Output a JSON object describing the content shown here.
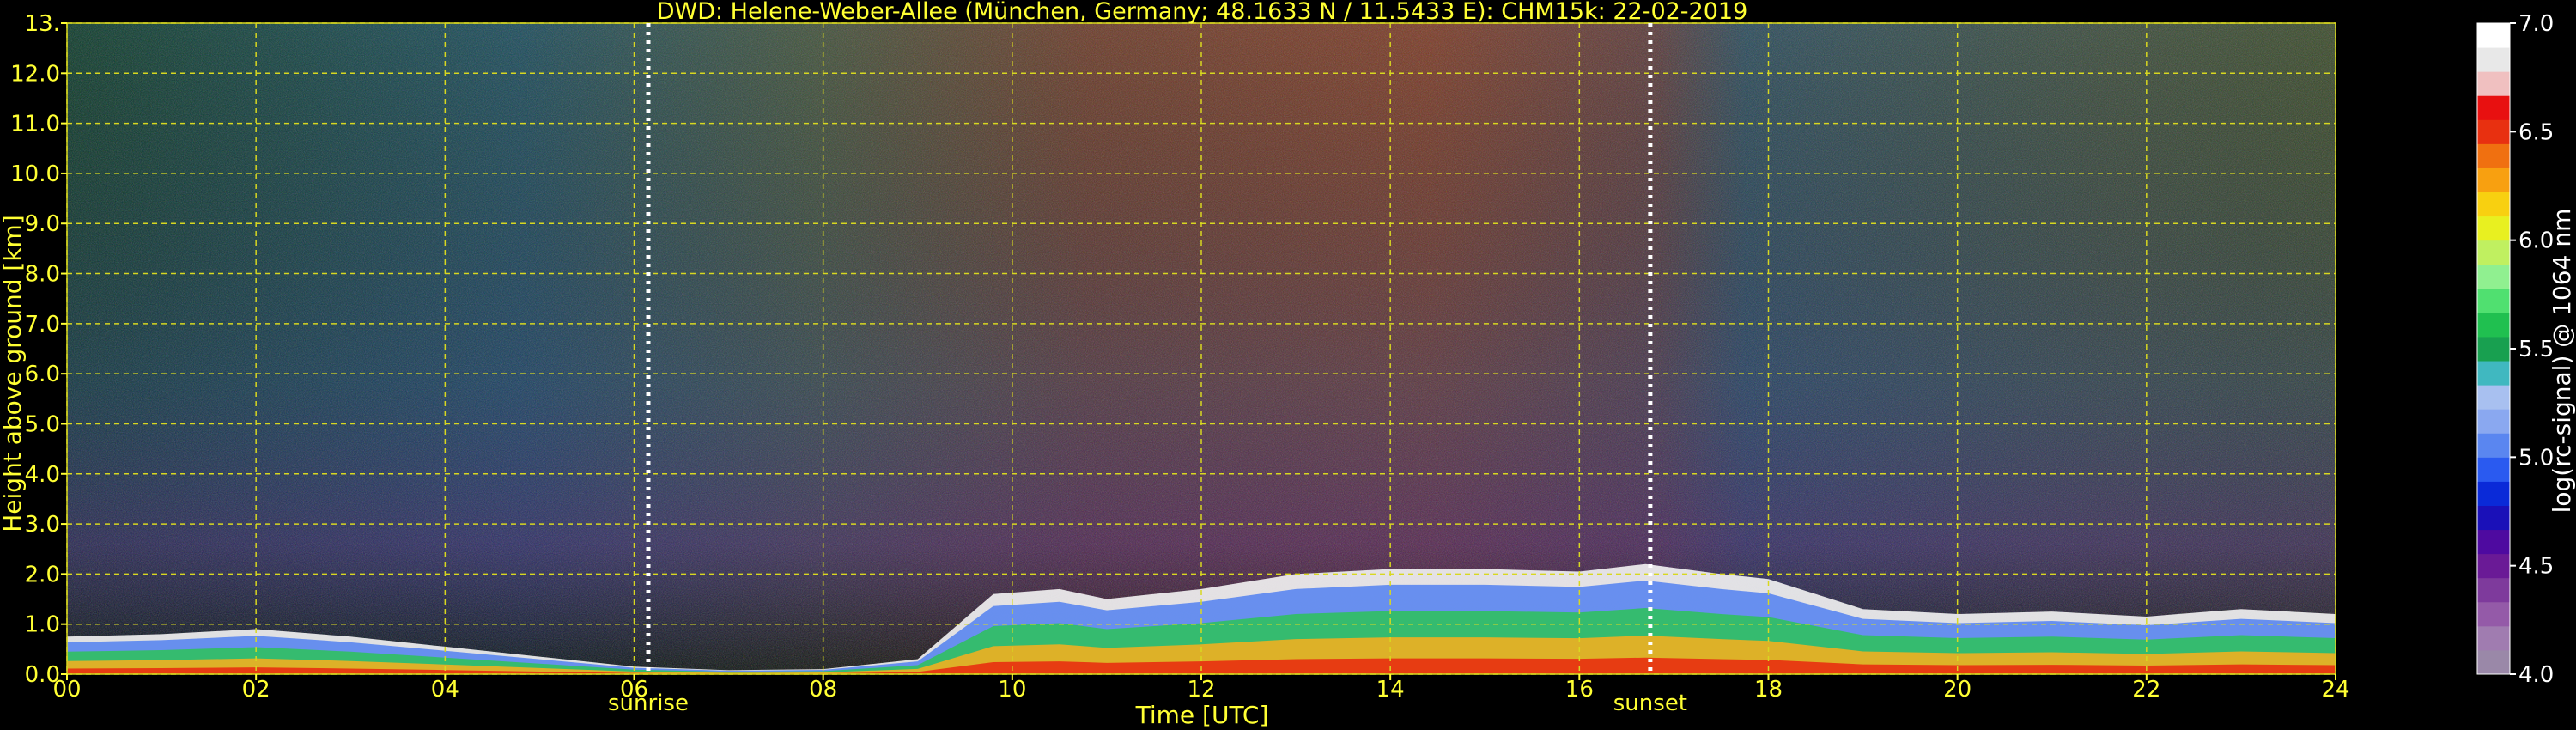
{
  "chart_data": {
    "type": "heatmap",
    "title": "DWD: Helene-Weber-Allee (München, Germany; 48.1633 N / 11.5433 E):    CHM15k: 22-02-2019",
    "xlabel": "Time [UTC]",
    "ylabel": "Height above ground [km]",
    "xlim": [
      0,
      24
    ],
    "ylim": [
      0,
      13
    ],
    "x_ticks": [
      "00",
      "02",
      "04",
      "06",
      "08",
      "10",
      "12",
      "14",
      "16",
      "18",
      "20",
      "22",
      "24"
    ],
    "y_ticks": [
      "0.0",
      "1.0",
      "2.0",
      "3.0",
      "4.0",
      "5.0",
      "6.0",
      "7.0",
      "8.0",
      "9.0",
      "10.0",
      "11.0",
      "12.0",
      "13."
    ],
    "grid": true,
    "colorbar": {
      "label": "log(rc-signal) @ 1064 nm",
      "range": [
        4.0,
        7.0
      ],
      "ticks": [
        "4.0",
        "4.5",
        "5.0",
        "5.5",
        "6.0",
        "6.5",
        "7.0"
      ],
      "colors": [
        "#9a88a8",
        "#a07cb0",
        "#945aa8",
        "#7e3a9c",
        "#6a1a96",
        "#4e0aa0",
        "#1a10b8",
        "#0a2ad8",
        "#2a5af0",
        "#5a86f0",
        "#8aa8f0",
        "#a8c0f0",
        "#40b8c0",
        "#18a050",
        "#20c050",
        "#50e070",
        "#90f090",
        "#c0f060",
        "#e8f020",
        "#f8d010",
        "#f8a010",
        "#f07010",
        "#e83010",
        "#e81010",
        "#f0c0c0",
        "#e8e8e8",
        "#ffffff"
      ]
    },
    "annotations": [
      {
        "text": "sunrise",
        "x": 6.15
      },
      {
        "text": "sunset",
        "x": 16.75
      }
    ],
    "boundary_layer": [
      [
        0,
        0.75
      ],
      [
        1,
        0.8
      ],
      [
        2,
        0.9
      ],
      [
        3,
        0.75
      ],
      [
        4,
        0.55
      ],
      [
        5,
        0.35
      ],
      [
        6,
        0.15
      ],
      [
        7,
        0.08
      ],
      [
        8,
        0.1
      ],
      [
        9,
        0.3
      ],
      [
        9.8,
        1.6
      ],
      [
        10.5,
        1.7
      ],
      [
        11,
        1.5
      ],
      [
        12,
        1.7
      ],
      [
        13,
        2.0
      ],
      [
        14,
        2.1
      ],
      [
        15,
        2.1
      ],
      [
        16,
        2.05
      ],
      [
        16.7,
        2.2
      ],
      [
        17.5,
        2.0
      ],
      [
        18,
        1.9
      ],
      [
        19,
        1.3
      ],
      [
        20,
        1.2
      ],
      [
        21,
        1.25
      ],
      [
        22,
        1.15
      ],
      [
        23,
        1.3
      ],
      [
        24,
        1.2
      ]
    ]
  }
}
